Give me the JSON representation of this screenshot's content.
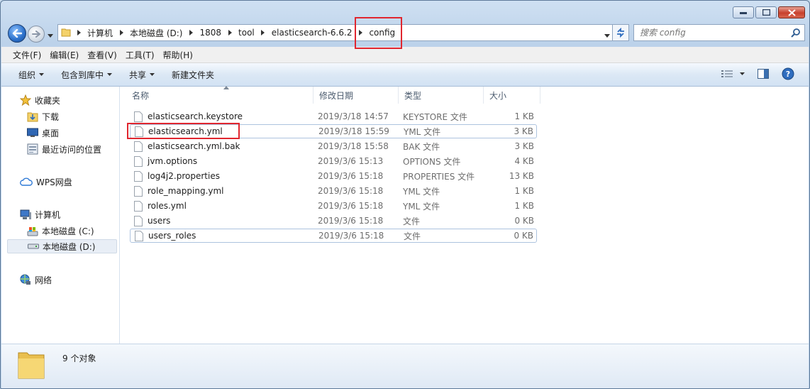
{
  "address": {
    "crumbs": [
      "计算机",
      "本地磁盘 (D:)",
      "1808",
      "tool",
      "elasticsearch-6.6.2",
      "config"
    ]
  },
  "search": {
    "placeholder": "搜索 config"
  },
  "menu": [
    "文件(F)",
    "编辑(E)",
    "查看(V)",
    "工具(T)",
    "帮助(H)"
  ],
  "toolbar": {
    "organize": "组织",
    "include_in_library": "包含到库中",
    "share": "共享",
    "new_folder": "新建文件夹"
  },
  "navpane": {
    "favorites": "收藏夹",
    "downloads": "下载",
    "desktop": "桌面",
    "recent": "最近访问的位置",
    "wps": "WPS网盘",
    "computer": "计算机",
    "drive_c": "本地磁盘 (C:)",
    "drive_d": "本地磁盘 (D:)",
    "network": "网络"
  },
  "columns": {
    "name": "名称",
    "modified": "修改日期",
    "type": "类型",
    "size": "大小"
  },
  "files": [
    {
      "name": "elasticsearch.keystore",
      "modified": "2019/3/18 14:57",
      "type": "KEYSTORE 文件",
      "size": "1 KB"
    },
    {
      "name": "elasticsearch.yml",
      "modified": "2019/3/18 15:59",
      "type": "YML 文件",
      "size": "3 KB"
    },
    {
      "name": "elasticsearch.yml.bak",
      "modified": "2019/3/18 15:58",
      "type": "BAK 文件",
      "size": "3 KB"
    },
    {
      "name": "jvm.options",
      "modified": "2019/3/6 15:13",
      "type": "OPTIONS 文件",
      "size": "4 KB"
    },
    {
      "name": "log4j2.properties",
      "modified": "2019/3/6 15:18",
      "type": "PROPERTIES 文件",
      "size": "13 KB"
    },
    {
      "name": "role_mapping.yml",
      "modified": "2019/3/6 15:18",
      "type": "YML 文件",
      "size": "1 KB"
    },
    {
      "name": "roles.yml",
      "modified": "2019/3/6 15:18",
      "type": "YML 文件",
      "size": "1 KB"
    },
    {
      "name": "users",
      "modified": "2019/3/6 15:18",
      "type": "文件",
      "size": "0 KB"
    },
    {
      "name": "users_roles",
      "modified": "2019/3/6 15:18",
      "type": "文件",
      "size": "0 KB"
    }
  ],
  "details": {
    "count": "9 个对象"
  },
  "colors": {
    "highlight_red": "#e0262f",
    "accent_blue": "#2a6fc9"
  }
}
